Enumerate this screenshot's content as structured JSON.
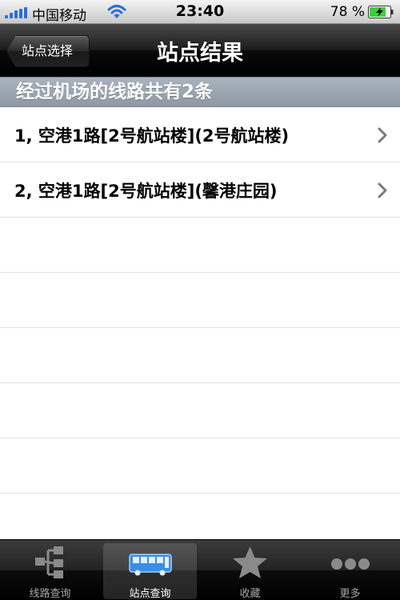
{
  "status_bar": {
    "carrier": "中国移动",
    "time": "23:40",
    "battery": "78 %"
  },
  "nav": {
    "back_label": "站点选择",
    "title": "站点结果"
  },
  "section": {
    "header": "经过机场的线路共有2条"
  },
  "routes": [
    {
      "label": "1, 空港1路[2号航站楼](2号航站楼)"
    },
    {
      "label": "2, 空港1路[2号航站楼](馨港庄园)"
    }
  ],
  "tabs": [
    {
      "label": "线路查询",
      "icon": "route-tree-icon",
      "selected": false
    },
    {
      "label": "站点查询",
      "icon": "bus-icon",
      "selected": true
    },
    {
      "label": "收藏",
      "icon": "star-icon",
      "selected": false
    },
    {
      "label": "更多",
      "icon": "more-dots-icon",
      "selected": false
    }
  ],
  "colors": {
    "signal": "#2a6fd6",
    "battery_fill": "#3cd03c",
    "section_header": "#9aa5b0",
    "bus_icon": "#3a8ee6"
  }
}
